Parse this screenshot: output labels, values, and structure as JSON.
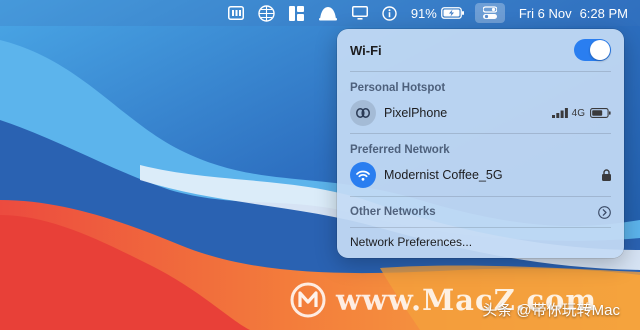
{
  "menubar": {
    "battery_percent": "91%",
    "date": "Fri 6 Nov",
    "time": "6:28 PM",
    "icons": [
      "calendar-app-icon",
      "globe-app-icon",
      "layout-app-icon",
      "bell-app-icon",
      "display-icon",
      "info-icon",
      "battery-charging-icon",
      "control-center-icon"
    ]
  },
  "wifi_panel": {
    "title": "Wi-Fi",
    "wifi_enabled": true,
    "personal_hotspot": {
      "heading": "Personal Hotspot",
      "name": "PixelPhone",
      "network_type": "4G",
      "icons": [
        "link-icon",
        "cellular-signal-icon",
        "battery-icon"
      ]
    },
    "preferred_network": {
      "heading": "Preferred Network",
      "name": "Modernist Coffee_5G",
      "icons": [
        "wifi-icon",
        "lock-icon"
      ]
    },
    "other_networks": {
      "label": "Other Networks",
      "icon": "chevron-right-circle-icon"
    },
    "preferences": {
      "label": "Network Preferences..."
    }
  },
  "watermark": {
    "site": "www.MacZ.com",
    "caption": "头条 @带你玩转Mac"
  },
  "colors": {
    "accent": "#2a7ef0",
    "panel_bg": "#c4daf4"
  }
}
